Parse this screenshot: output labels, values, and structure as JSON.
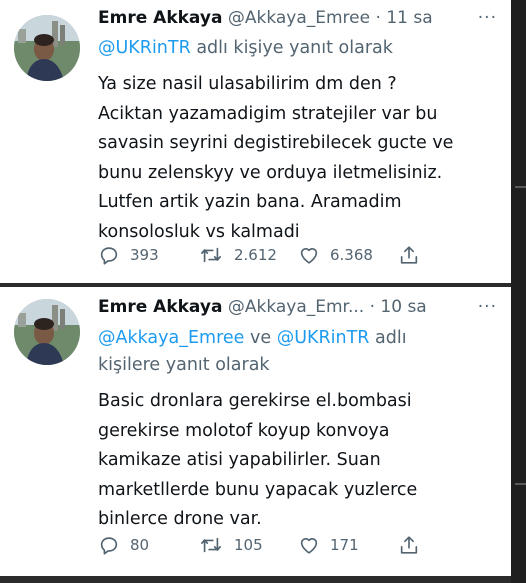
{
  "tweets": [
    {
      "name": "Emre Akkaya",
      "handle": "@Akkaya_Emree",
      "time": "· 11 sa",
      "more": "···",
      "reply": {
        "mention1": "@UKRinTR",
        "joiner": "",
        "mention2": "",
        "suffix_line1": " adlı kişiye yanıt olarak",
        "suffix_line2": ""
      },
      "text_lines": [
        "Ya size nasil ulasabilirim dm den ?",
        "Aciktan yazamadigim stratejiler var bu",
        "savasin seyrini degistirebilecek gucte ve",
        "bunu zelenskyy ve orduya iletmelisiniz.",
        "Lutfen artik yazin bana.  Aramadim",
        "konsolosluk vs kalmadi"
      ],
      "replies": "393",
      "retweets": "2.612",
      "likes": "6.368"
    },
    {
      "name": "Emre Akkaya",
      "handle": "@Akkaya_Emr...",
      "time": "· 10 sa",
      "more": "···",
      "reply": {
        "mention1": "@Akkaya_Emree",
        "joiner": " ve ",
        "mention2": "@UKRinTR",
        "suffix_line1": " adlı",
        "suffix_line2": "kişilere yanıt olarak"
      },
      "text_lines": [
        "Basic dronlara gerekirse el.bombasi",
        "gerekirse molotof koyup konvoya",
        "kamikaze atisi yapabilirler. Suan",
        "marketllerde bunu yapacak yuzlerce",
        "binlerce drone var."
      ],
      "replies": "80",
      "retweets": "105",
      "likes": "171"
    }
  ],
  "icons": {
    "reply": "speech-bubble-icon",
    "retweet": "retweet-arrows-icon",
    "like": "heart-outline-icon",
    "share": "share-upload-icon",
    "more": "three-dots-icon"
  },
  "colors": {
    "background": "#ffffff",
    "text": "#0f1419",
    "muted": "#536471",
    "link": "#1d9bf0",
    "separator": "#2b2b2b"
  }
}
